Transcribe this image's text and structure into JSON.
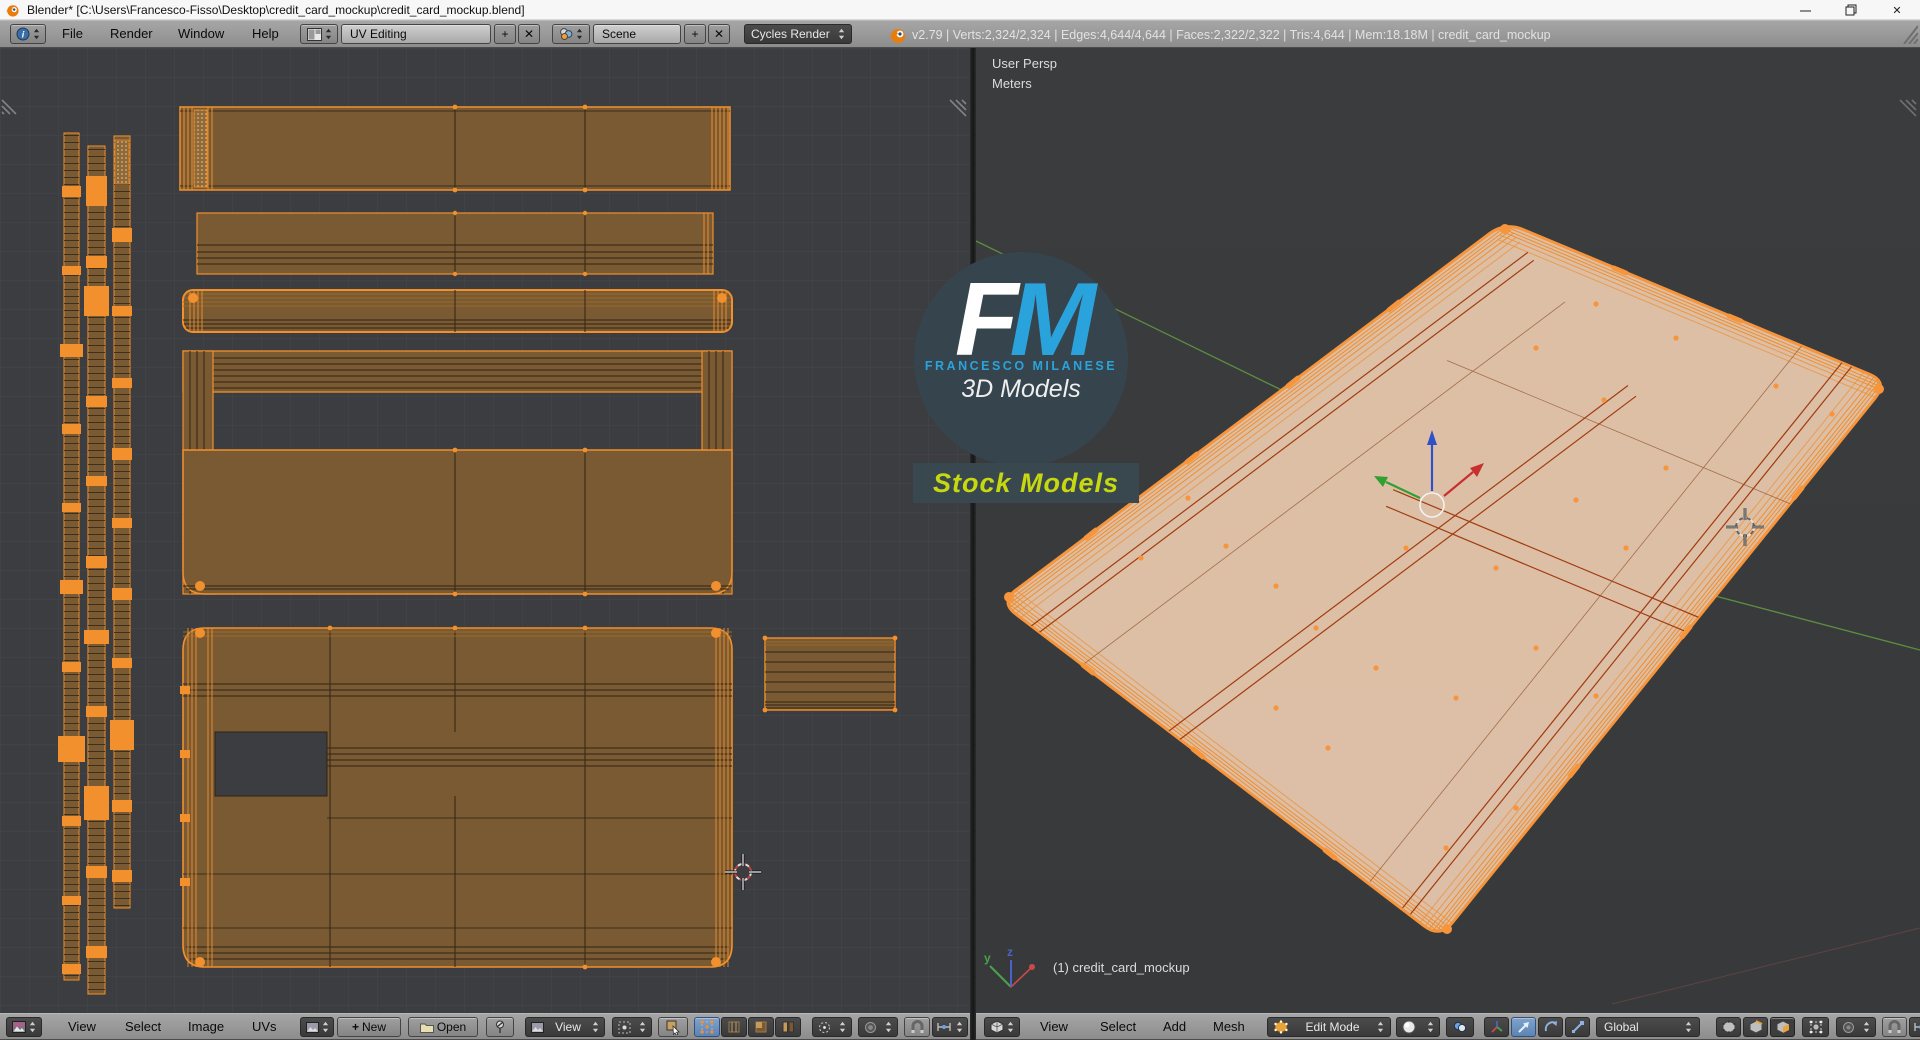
{
  "titlebar": {
    "title": "Blender* [C:\\Users\\Francesco-Fisso\\Desktop\\credit_card_mockup\\credit_card_mockup.blend]"
  },
  "topbar": {
    "menus": [
      "File",
      "Render",
      "Window",
      "Help"
    ],
    "layout_value": "UV Editing",
    "scene_value": "Scene",
    "engine_value": "Cycles Render",
    "stats": "v2.79 | Verts:2,324/2,324 | Edges:4,644/4,644 | Faces:2,322/2,322 | Tris:4,644 | Mem:18.18M | credit_card_mockup"
  },
  "uv_editor": {
    "menus": [
      "View",
      "Select",
      "Image",
      "UVs"
    ],
    "new_button": "New",
    "open_button": "Open",
    "view_dropdown": "View"
  },
  "viewport": {
    "view_label": "User Persp",
    "unit_label": "Meters",
    "object_label": "(1) credit_card_mockup",
    "axis_y": "y",
    "axis_z": "z",
    "menus": [
      "View",
      "Select",
      "Add",
      "Mesh"
    ],
    "mode_value": "Edit Mode",
    "orientation_value": "Global"
  },
  "watermark": {
    "letter_f": "F",
    "letter_m": "M",
    "name": "FRANCESCO MILANESE",
    "subtitle": "3D Models",
    "band": "Stock Models"
  },
  "icons": {
    "close": "✕",
    "plus": "+"
  },
  "colors": {
    "selection_orange": "#f1902c",
    "uv_fill_brown": "#7a5a32",
    "accent_blue": "#5c83b4",
    "watermark_blue": "#2aa3dc",
    "band_yellow": "#c6d80f"
  }
}
